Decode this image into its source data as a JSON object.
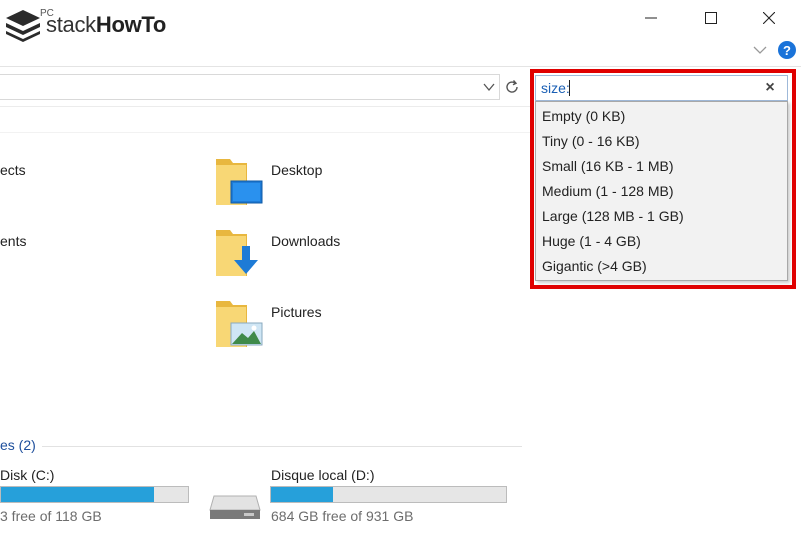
{
  "window": {
    "title_partial": "PC",
    "logo_text": "stackHowTo"
  },
  "search": {
    "query": "size:",
    "clear_symbol": "×",
    "suggestions": [
      "Empty (0 KB)",
      "Tiny (0 - 16 KB)",
      "Small (16 KB - 1 MB)",
      "Medium (1 - 128 MB)",
      "Large (128 MB - 1 GB)",
      "Huge (1 - 4 GB)",
      "Gigantic (>4 GB)"
    ]
  },
  "help": {
    "label": "?"
  },
  "folders": {
    "left_partial": [
      "ects",
      "ents"
    ],
    "items": [
      {
        "label": "Desktop",
        "icon": "desktop-folder-icon"
      },
      {
        "label": "Downloads",
        "icon": "downloads-folder-icon"
      },
      {
        "label": "Pictures",
        "icon": "pictures-folder-icon"
      }
    ]
  },
  "devices": {
    "section_label": "es (2)",
    "drives": [
      {
        "label": "Disk (C:)",
        "free_text": "3 free of 118 GB",
        "used_fraction": 0.82
      },
      {
        "label": "Disque local (D:)",
        "free_text": "684 GB free of 931 GB",
        "used_fraction": 0.265
      }
    ]
  },
  "colors": {
    "accent": "#1a73d9",
    "drive_fill": "#26a0da",
    "highlight": "#e00000"
  }
}
